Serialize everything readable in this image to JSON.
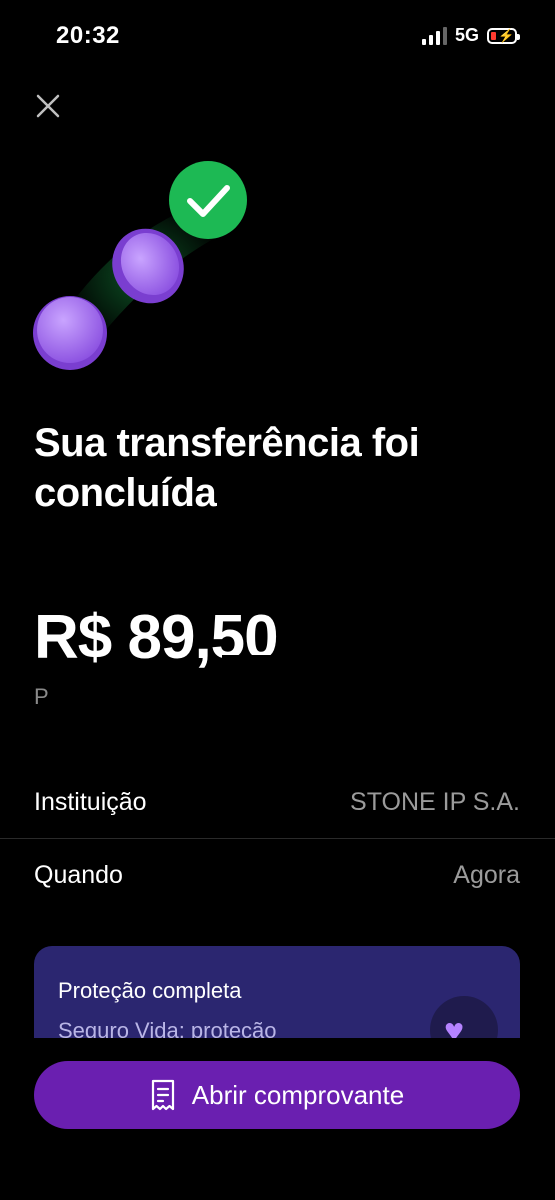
{
  "status_bar": {
    "time": "20:32",
    "network": "5G"
  },
  "title": "Sua transferência foi concluída",
  "amount": "R$ 89,50",
  "amount_sub": "P",
  "details": [
    {
      "label": "Instituição",
      "value": "STONE IP S.A."
    },
    {
      "label": "Quando",
      "value": "Agora"
    }
  ],
  "promo": {
    "title": "Proteção completa",
    "subtitle": "Seguro Vida: proteção",
    "icon": "heart-icon"
  },
  "cta": {
    "label": "Abrir comprovante",
    "icon": "receipt-icon"
  },
  "colors": {
    "background": "#000000",
    "accent": "#6a1fb0",
    "success": "#1db954",
    "coin": "#a874f0",
    "promo_bg": "#2b2670"
  }
}
